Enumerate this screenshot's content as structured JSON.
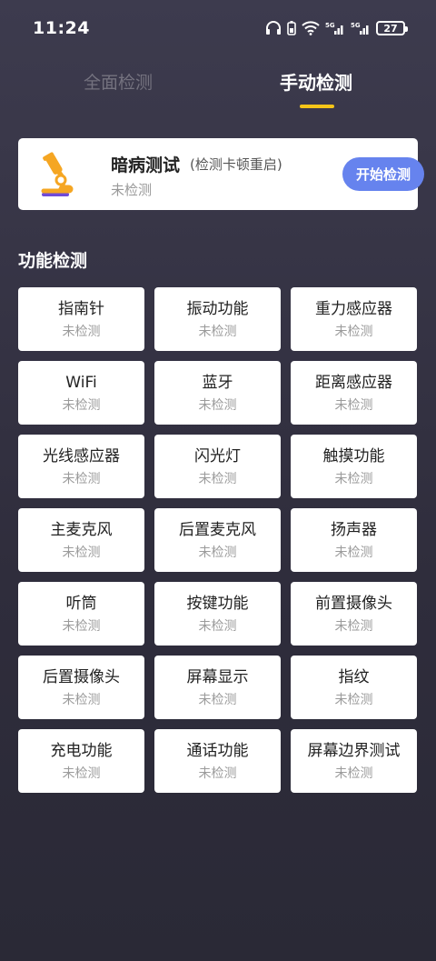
{
  "status_bar": {
    "time": "11:24",
    "battery": "27",
    "icons": [
      "headphones-icon",
      "battery-saver-icon",
      "wifi-icon",
      "signal-5g-icon",
      "signal-5g-icon",
      "battery-icon"
    ]
  },
  "tabs": [
    {
      "label": "全面检测",
      "active": false
    },
    {
      "label": "手动检测",
      "active": true
    }
  ],
  "test_card": {
    "title": "暗病测试",
    "subtitle": "(检测卡顿重启)",
    "status": "未检测",
    "button": "开始检测",
    "icon": "microscope-icon"
  },
  "section_title": "功能检测",
  "items": [
    {
      "name": "指南针",
      "status": "未检测"
    },
    {
      "name": "振动功能",
      "status": "未检测"
    },
    {
      "name": "重力感应器",
      "status": "未检测"
    },
    {
      "name": "WiFi",
      "status": "未检测"
    },
    {
      "name": "蓝牙",
      "status": "未检测"
    },
    {
      "name": "距离感应器",
      "status": "未检测"
    },
    {
      "name": "光线感应器",
      "status": "未检测"
    },
    {
      "name": "闪光灯",
      "status": "未检测"
    },
    {
      "name": "触摸功能",
      "status": "未检测"
    },
    {
      "name": "主麦克风",
      "status": "未检测"
    },
    {
      "name": "后置麦克风",
      "status": "未检测"
    },
    {
      "name": "扬声器",
      "status": "未检测"
    },
    {
      "name": "听筒",
      "status": "未检测"
    },
    {
      "name": "按键功能",
      "status": "未检测"
    },
    {
      "name": "前置摄像头",
      "status": "未检测"
    },
    {
      "name": "后置摄像头",
      "status": "未检测"
    },
    {
      "name": "屏幕显示",
      "status": "未检测"
    },
    {
      "name": "指纹",
      "status": "未检测"
    },
    {
      "name": "充电功能",
      "status": "未检测"
    },
    {
      "name": "通话功能",
      "status": "未检测"
    },
    {
      "name": "屏幕边界测试",
      "status": "未检测"
    }
  ],
  "colors": {
    "background": "#3d3b4e",
    "accent": "#f5c518",
    "button": "#6683ee",
    "icon_orange": "#f5a623"
  }
}
